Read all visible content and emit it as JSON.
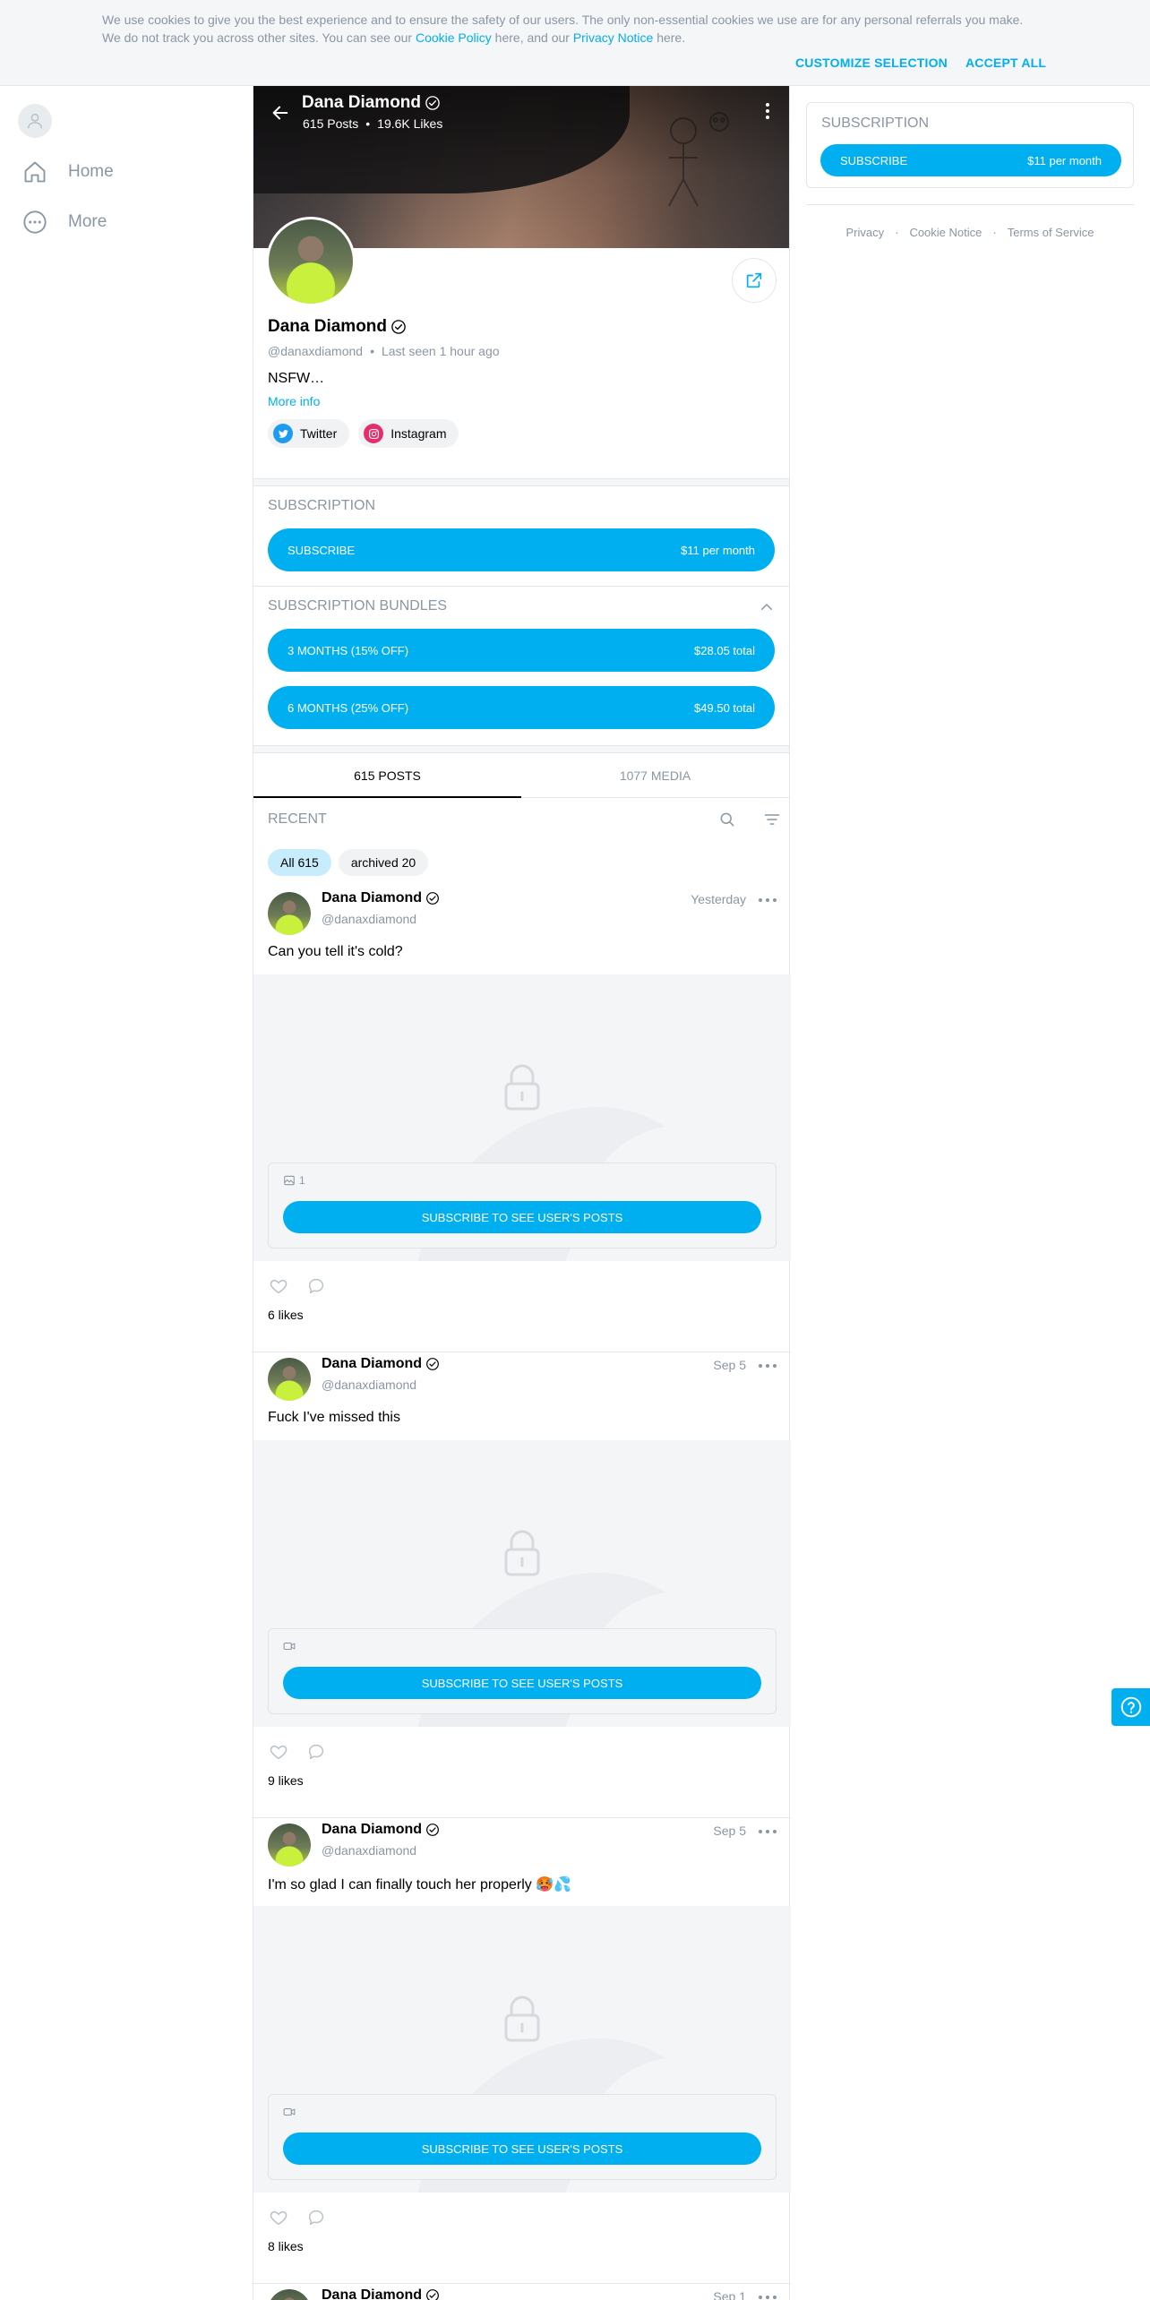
{
  "cookie_banner": {
    "text_part1": "We use cookies to give you the best experience and to ensure the safety of our users. The only non-essential cookies we use are for any personal referrals you make. We do not track you across other sites. You can see our ",
    "cookie_policy_link": "Cookie Policy",
    "text_part2": " here, and our ",
    "privacy_notice_link": "Privacy Notice",
    "text_part3": " here.",
    "customize_label": "CUSTOMIZE SELECTION",
    "accept_label": "ACCEPT ALL"
  },
  "left_nav": {
    "items": [
      {
        "label": "Home",
        "icon": "home-icon"
      },
      {
        "label": "More",
        "icon": "more-icon"
      }
    ]
  },
  "profile": {
    "cover_name": "Dana Diamond",
    "name_prefix": "",
    "name_suffix": "",
    "posts_count": "615 Posts",
    "likes_count": "19.6K Likes",
    "handle": "@danaxdiamond",
    "last_seen": "Last seen 1 hour ago",
    "bio": "NSFW…",
    "more_info": "More info",
    "socials": [
      {
        "label": "Twitter",
        "icon": "twitter-icon",
        "color": "#1d9bf0"
      },
      {
        "label": "Instagram",
        "icon": "instagram-icon",
        "color": "#e1306c"
      }
    ]
  },
  "subscription": {
    "title": "SUBSCRIPTION",
    "button_label": "SUBSCRIBE",
    "price": "$11 per month"
  },
  "bundles": {
    "title": "SUBSCRIPTION BUNDLES",
    "items": [
      {
        "label": "3 MONTHS (15% off)",
        "price": "$28.05 total"
      },
      {
        "label": "6 MONTHS (25% off)",
        "price": "$49.50 total"
      }
    ]
  },
  "tabs": [
    {
      "label": "615 POSTS",
      "active": true
    },
    {
      "label": "1077 MEDIA",
      "active": false
    }
  ],
  "feed": {
    "recent_label": "RECENT",
    "chips": [
      {
        "label": "All 615",
        "active": true
      },
      {
        "label": "archived 20",
        "active": false
      }
    ]
  },
  "posts": [
    {
      "name": "Dana Diamond",
      "handle": "@danaxdiamond",
      "date": "Yesterday",
      "text": "Can you tell it's cold?",
      "media_type": "image-icon",
      "media_count": "1",
      "button": "SUBSCRIBE TO SEE USER'S POSTS",
      "likes": "6 likes"
    },
    {
      "name": "Dana Diamond",
      "handle": "@danaxdiamond",
      "date": "Sep 5",
      "text": "Fuck I've missed this",
      "media_type": "video-icon",
      "media_count": "",
      "button": "SUBSCRIBE TO SEE USER'S POSTS",
      "likes": "9 likes"
    },
    {
      "name": "Dana Diamond",
      "handle": "@danaxdiamond",
      "date": "Sep 5",
      "text": "I'm so glad I can finally touch her properly 🥵💦",
      "media_type": "video-icon",
      "media_count": "",
      "button": "SUBSCRIBE TO SEE USER'S POSTS",
      "likes": "8 likes"
    },
    {
      "name": "Dana Diamond",
      "handle": "",
      "date": "Sep 1",
      "text": "",
      "media_type": "",
      "media_count": "",
      "button": "",
      "likes": ""
    }
  ],
  "right": {
    "subscription_title": "SUBSCRIPTION",
    "subscribe_label": "SUBSCRIBE",
    "price": "$11 per month",
    "footer_links": [
      "Privacy",
      "Cookie Notice",
      "Terms of Service"
    ]
  },
  "colors": {
    "accent": "#00aff0",
    "muted": "#8a96a3",
    "divider": "#e4e6ea"
  }
}
